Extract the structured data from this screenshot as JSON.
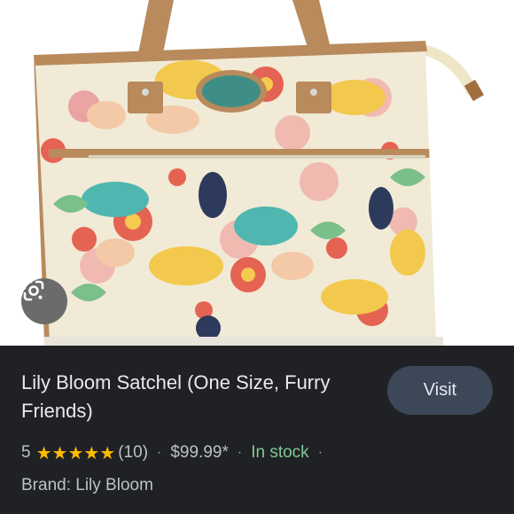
{
  "product": {
    "title": "Lily Bloom Satchel (One Size, Furry Friends)",
    "rating": "5",
    "stars": "★★★★★",
    "review_count": "(10)",
    "separator": "·",
    "price": "$99.99*",
    "availability": "In stock",
    "brand": "Brand: Lily Bloom"
  },
  "actions": {
    "visit_label": "Visit"
  },
  "icons": {
    "lens": "google-lens-icon",
    "star": "star-icon"
  },
  "colors": {
    "panel_bg": "#202124",
    "text_primary": "#e8eaed",
    "text_secondary": "#bdc1c6",
    "star": "#fbbc04",
    "in_stock": "#81c995",
    "visit_button_bg": "#3c4758"
  }
}
